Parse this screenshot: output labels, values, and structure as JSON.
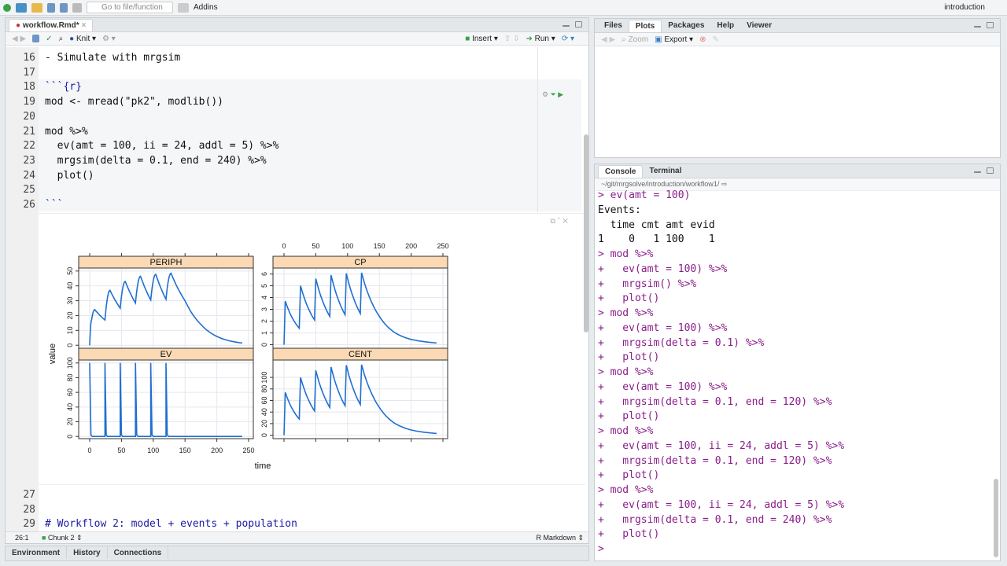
{
  "toolbar": {
    "goto_placeholder": "Go to file/function",
    "addins": "Addins",
    "project": "introduction"
  },
  "editor": {
    "tab": "workflow.Rmd*",
    "knit": "Knit",
    "insert": "Insert",
    "run": "Run",
    "lines": [
      {
        "n": "16",
        "text": "- Simulate with mrgsim"
      },
      {
        "n": "17",
        "text": ""
      },
      {
        "n": "18",
        "text": "```{r}"
      },
      {
        "n": "19",
        "text": "mod <- mread(\"pk2\", modlib())"
      },
      {
        "n": "20",
        "text": ""
      },
      {
        "n": "21",
        "text": "mod %>%"
      },
      {
        "n": "22",
        "text": "  ev(amt = 100, ii = 24, addl = 5) %>%"
      },
      {
        "n": "23",
        "text": "  mrgsim(delta = 0.1, end = 240) %>%"
      },
      {
        "n": "24",
        "text": "  plot()"
      },
      {
        "n": "25",
        "text": ""
      },
      {
        "n": "26",
        "text": "```"
      }
    ],
    "lines_after": [
      {
        "n": "27",
        "text": ""
      },
      {
        "n": "28",
        "text": ""
      },
      {
        "n": "29",
        "text": "# Workflow 2: model + events + population"
      }
    ],
    "status": {
      "position": "26:1",
      "chunk": "Chunk 2",
      "mode": "R Markdown"
    }
  },
  "bottom_left_tabs": [
    "Environment",
    "History",
    "Connections"
  ],
  "plots_pane": {
    "tabs": [
      "Files",
      "Plots",
      "Packages",
      "Help",
      "Viewer"
    ],
    "active": "Plots",
    "zoom": "Zoom",
    "export": "Export"
  },
  "console": {
    "tabs": [
      "Console",
      "Terminal"
    ],
    "path": "~/git/mrgsolve/introduction/workflow1/",
    "lines": [
      {
        "t": "in",
        "text": "> ev(amt = 100)"
      },
      {
        "t": "out",
        "text": "Events:"
      },
      {
        "t": "out",
        "text": "  time cmt amt evid"
      },
      {
        "t": "out",
        "text": "1    0   1 100    1"
      },
      {
        "t": "in",
        "text": "> mod %>%"
      },
      {
        "t": "in",
        "text": "+   ev(amt = 100) %>%"
      },
      {
        "t": "in",
        "text": "+   mrgsim() %>%"
      },
      {
        "t": "in",
        "text": "+   plot()"
      },
      {
        "t": "in",
        "text": "> mod %>%"
      },
      {
        "t": "in",
        "text": "+   ev(amt = 100) %>%"
      },
      {
        "t": "in",
        "text": "+   mrgsim(delta = 0.1) %>%"
      },
      {
        "t": "in",
        "text": "+   plot()"
      },
      {
        "t": "in",
        "text": "> mod %>%"
      },
      {
        "t": "in",
        "text": "+   ev(amt = 100) %>%"
      },
      {
        "t": "in",
        "text": "+   mrgsim(delta = 0.1, end = 120) %>%"
      },
      {
        "t": "in",
        "text": "+   plot()"
      },
      {
        "t": "in",
        "text": "> mod %>%"
      },
      {
        "t": "in",
        "text": "+   ev(amt = 100, ii = 24, addl = 5) %>%"
      },
      {
        "t": "in",
        "text": "+   mrgsim(delta = 0.1, end = 120) %>%"
      },
      {
        "t": "in",
        "text": "+   plot()"
      },
      {
        "t": "in",
        "text": "> mod %>%"
      },
      {
        "t": "in",
        "text": "+   ev(amt = 100, ii = 24, addl = 5) %>%"
      },
      {
        "t": "in",
        "text": "+   mrgsim(delta = 0.1, end = 240) %>%"
      },
      {
        "t": "in",
        "text": "+   plot()"
      },
      {
        "t": "in",
        "text": ">"
      }
    ]
  },
  "chart_data": {
    "type": "line",
    "xlabel": "time",
    "ylabel": "value",
    "xlim": [
      0,
      250
    ],
    "xticks": [
      0,
      50,
      100,
      150,
      200,
      250
    ],
    "line_color": "#1f6fd1",
    "strip_color": "#fad9b4",
    "panels": [
      {
        "name": "PERIPH",
        "ylim": [
          -2,
          52
        ],
        "yticks": [
          0,
          10,
          20,
          30,
          40,
          50
        ],
        "points": [
          [
            0,
            0
          ],
          [
            3,
            17
          ],
          [
            8,
            24
          ],
          [
            24,
            17
          ],
          [
            32,
            37
          ],
          [
            48,
            25
          ],
          [
            56,
            43
          ],
          [
            72,
            28.5
          ],
          [
            80,
            46.5
          ],
          [
            96,
            30.5
          ],
          [
            104,
            47.8
          ],
          [
            120,
            31
          ],
          [
            128,
            48.5
          ],
          [
            150,
            30
          ],
          [
            175,
            14
          ],
          [
            200,
            6
          ],
          [
            240,
            1.5
          ]
        ]
      },
      {
        "name": "CP",
        "ylim": [
          -0.3,
          6.5
        ],
        "yticks": [
          0,
          1,
          2,
          3,
          4,
          5,
          6
        ],
        "points": [
          [
            0,
            0
          ],
          [
            2,
            3.7
          ],
          [
            24,
            1.4
          ],
          [
            26,
            5.0
          ],
          [
            48,
            2.1
          ],
          [
            50,
            5.6
          ],
          [
            72,
            2.4
          ],
          [
            74,
            5.9
          ],
          [
            96,
            2.55
          ],
          [
            98,
            6.05
          ],
          [
            120,
            2.65
          ],
          [
            122,
            6.1
          ],
          [
            150,
            2.4
          ],
          [
            175,
            1.0
          ],
          [
            200,
            0.45
          ],
          [
            240,
            0.15
          ]
        ]
      },
      {
        "name": "EV",
        "ylim": [
          -3,
          104
        ],
        "yticks": [
          0,
          20,
          40,
          60,
          80,
          100
        ],
        "points": [
          [
            0,
            100
          ],
          [
            2,
            2
          ],
          [
            4,
            0
          ],
          [
            24,
            0
          ],
          [
            24,
            100
          ],
          [
            26,
            2
          ],
          [
            28,
            0
          ],
          [
            48,
            0
          ],
          [
            48,
            100
          ],
          [
            50,
            2
          ],
          [
            52,
            0
          ],
          [
            72,
            0
          ],
          [
            72,
            100
          ],
          [
            74,
            2
          ],
          [
            76,
            0
          ],
          [
            96,
            0
          ],
          [
            96,
            100
          ],
          [
            98,
            2
          ],
          [
            100,
            0
          ],
          [
            120,
            0
          ],
          [
            120,
            100
          ],
          [
            122,
            2
          ],
          [
            124,
            0
          ],
          [
            240,
            0
          ]
        ]
      },
      {
        "name": "CENT",
        "ylim": [
          -6,
          130
        ],
        "yticks": [
          0,
          20,
          40,
          60,
          80,
          100
        ],
        "points": [
          [
            0,
            0
          ],
          [
            2,
            74
          ],
          [
            24,
            28
          ],
          [
            26,
            100
          ],
          [
            48,
            42
          ],
          [
            50,
            112
          ],
          [
            72,
            48
          ],
          [
            74,
            118
          ],
          [
            96,
            51
          ],
          [
            98,
            121
          ],
          [
            120,
            53
          ],
          [
            122,
            122
          ],
          [
            150,
            48
          ],
          [
            175,
            20
          ],
          [
            200,
            9
          ],
          [
            240,
            3
          ]
        ]
      }
    ]
  }
}
